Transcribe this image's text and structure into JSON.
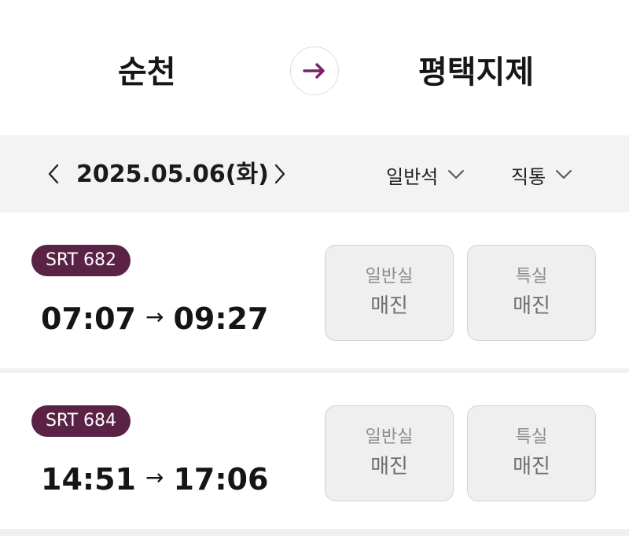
{
  "route": {
    "departure": "순천",
    "arrival": "평택지제"
  },
  "datebar": {
    "date": "2025.05.06(화)",
    "seat_filter": "일반석",
    "route_filter": "직통"
  },
  "trains": [
    {
      "name": "SRT 682",
      "departure_time": "07:07",
      "arrival_time": "09:27",
      "general_label": "일반실",
      "general_status": "매진",
      "special_label": "특실",
      "special_status": "매진"
    },
    {
      "name": "SRT 684",
      "departure_time": "14:51",
      "arrival_time": "17:06",
      "general_label": "일반실",
      "general_status": "매진",
      "special_label": "특실",
      "special_status": "매진"
    }
  ],
  "symbols": {
    "time_arrow": "→"
  },
  "icons": {
    "swap": "arrow-right-icon",
    "prev": "chevron-left-icon",
    "next": "chevron-right-icon",
    "dropdown": "chevron-down-icon"
  },
  "colors": {
    "badge": "#5a2244",
    "swap_arrow": "#7a1f6a",
    "header_bg": "#f3f3f3",
    "soldout_button_bg": "#efefef"
  }
}
